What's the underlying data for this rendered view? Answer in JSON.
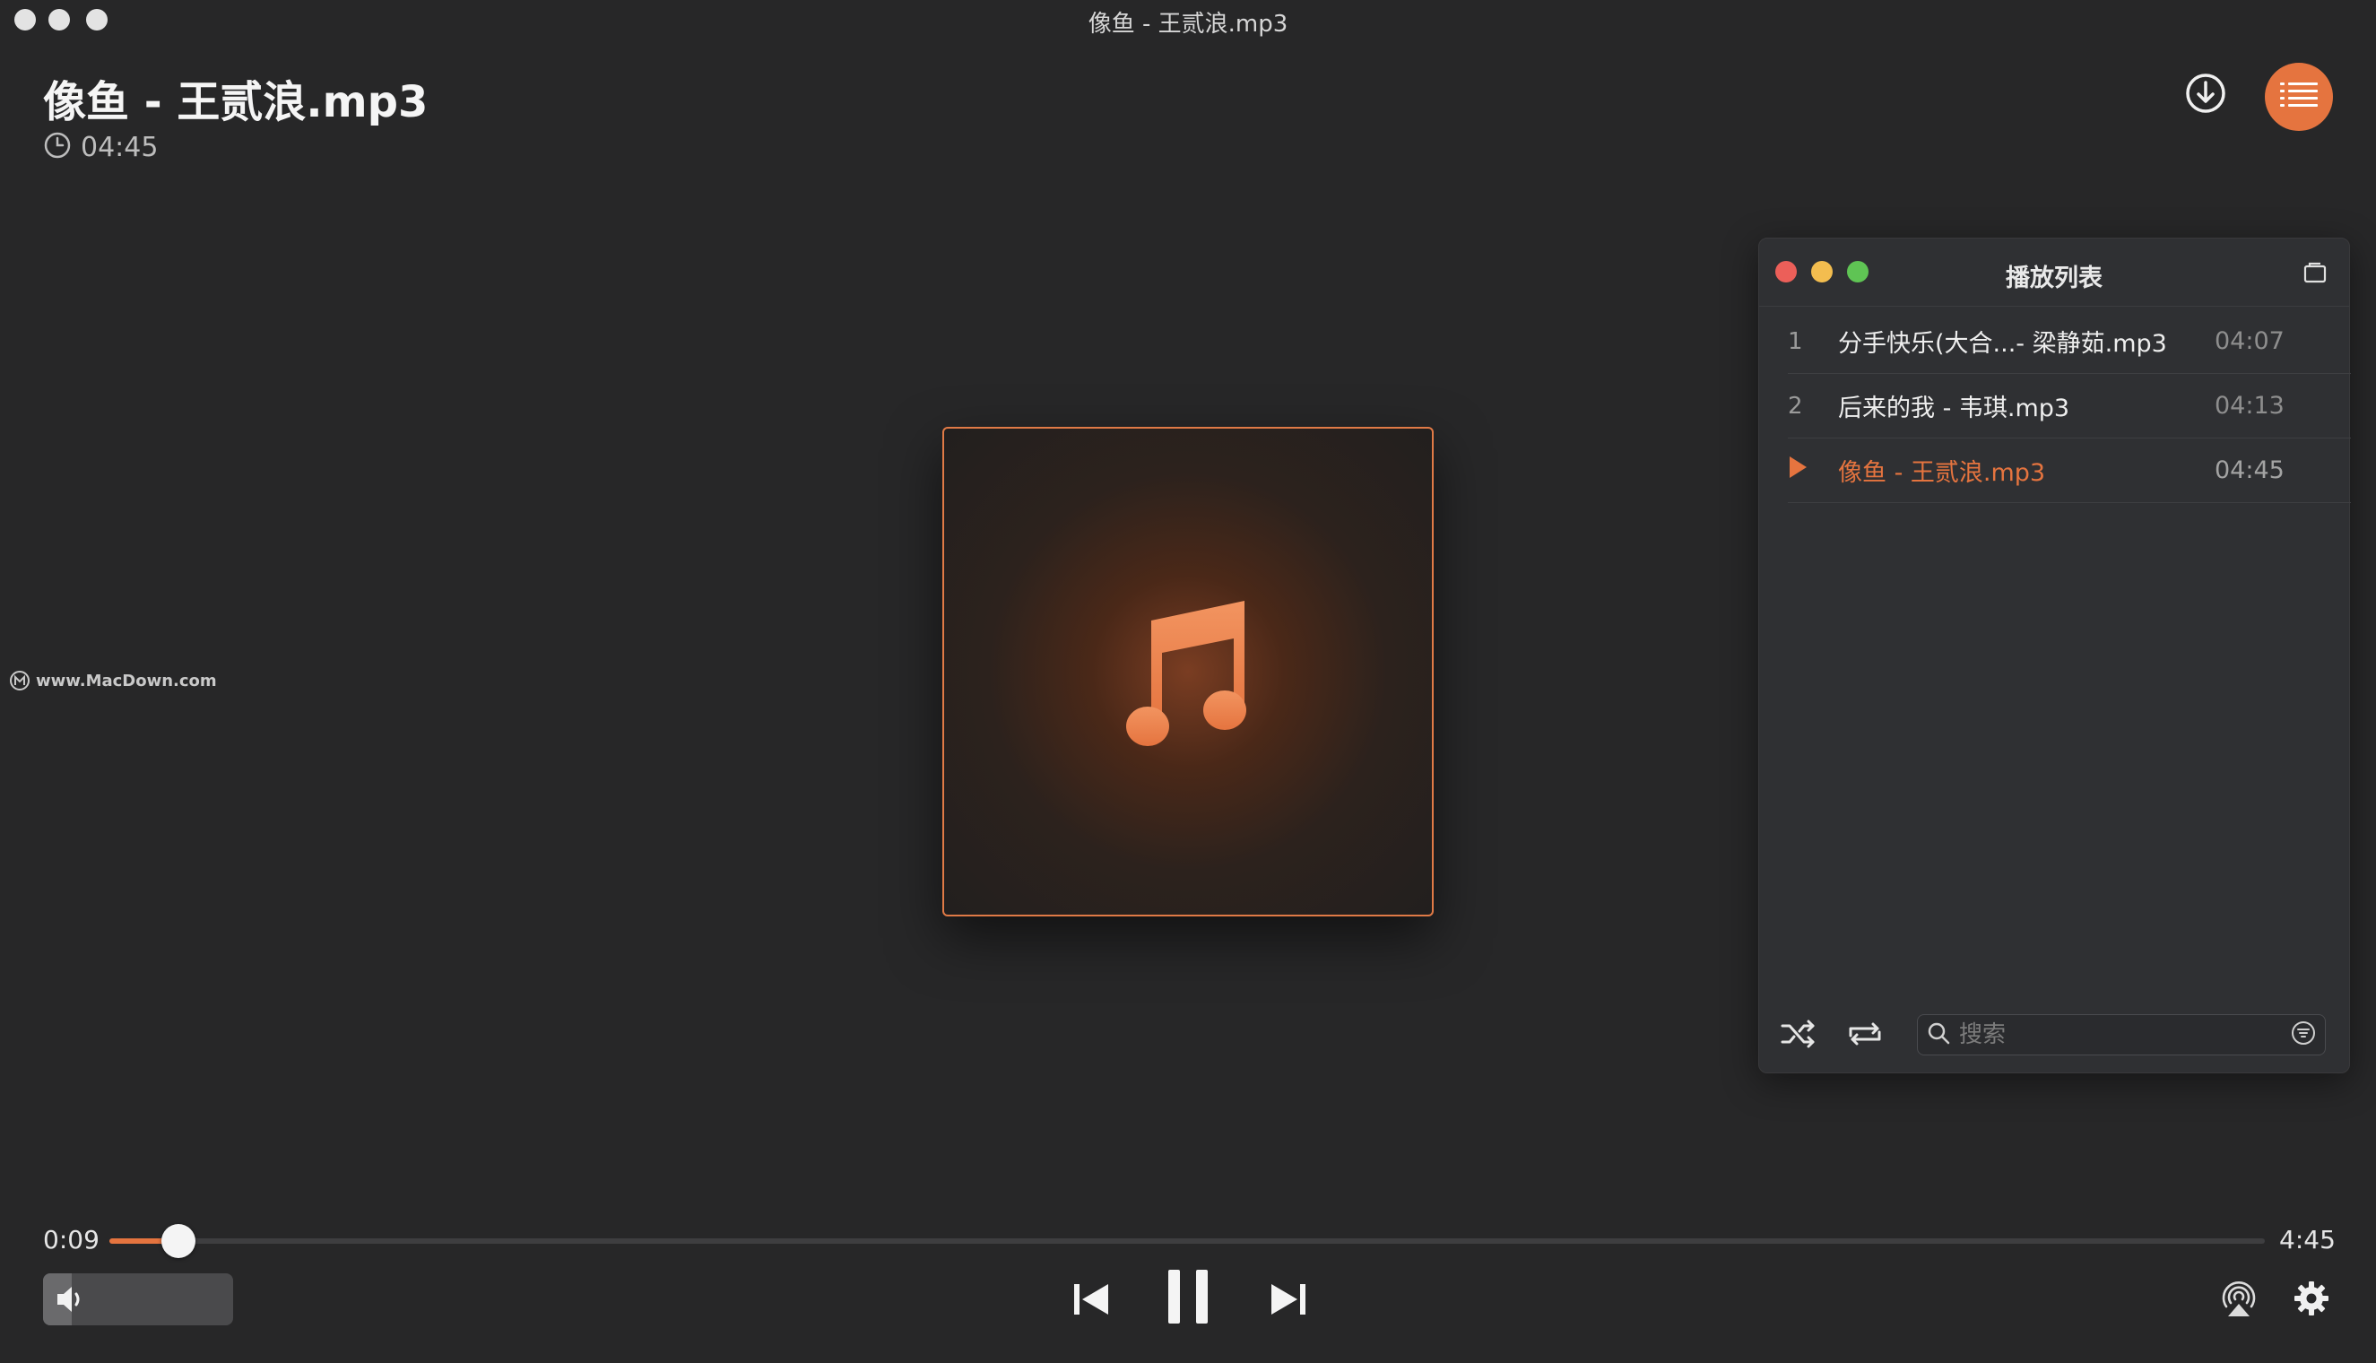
{
  "window": {
    "title": "像鱼 - 王贰浪.mp3"
  },
  "now_playing": {
    "title": "像鱼 - 王贰浪.mp3",
    "duration": "04:45"
  },
  "watermark": {
    "text": "www.MacDown.com"
  },
  "playlist": {
    "title": "播放列表",
    "items": [
      {
        "num": "1",
        "name": "分手快乐(大合...- 梁静茹.mp3",
        "time": "04:07",
        "active": false
      },
      {
        "num": "2",
        "name": "后来的我 - 韦琪.mp3",
        "time": "04:13",
        "active": false
      },
      {
        "num": "",
        "name": "像鱼 - 王贰浪.mp3",
        "time": "04:45",
        "active": true
      }
    ],
    "search_placeholder": "搜索"
  },
  "player": {
    "elapsed": "0:09",
    "total": "4:45",
    "progress_fraction": 0.032,
    "volume_fraction": 0.15
  },
  "colors": {
    "accent": "#e5743f",
    "background": "#272728",
    "panel": "#2f3033",
    "traffic_red": "#ec5f59",
    "traffic_yellow": "#f3bd4f",
    "traffic_green": "#5fc454"
  },
  "icons": {
    "download": "download-icon",
    "playlist": "list-icon",
    "music": "music-note-icon",
    "clock": "clock-icon",
    "shuffle": "shuffle-icon",
    "repeat": "repeat-icon",
    "search": "search-icon",
    "filter": "filter-icon",
    "previous": "previous-icon",
    "pause": "pause-icon",
    "next": "next-icon",
    "airplay": "airplay-icon",
    "settings": "gear-icon",
    "volume": "speaker-icon"
  }
}
